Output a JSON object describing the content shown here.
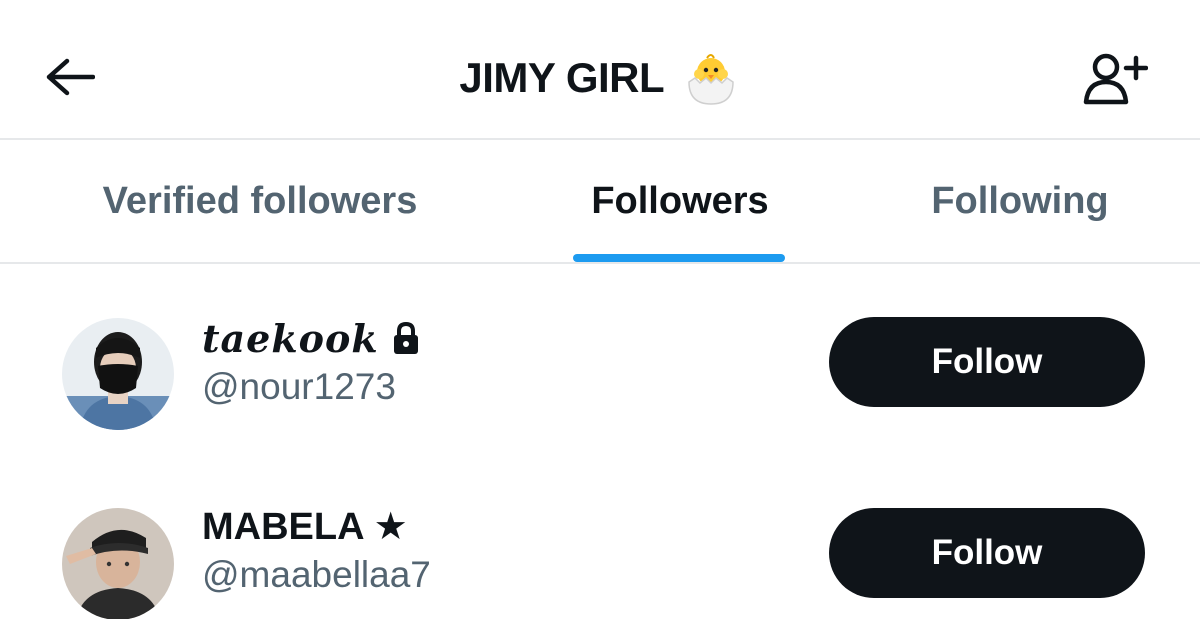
{
  "header": {
    "title": "JIMY GIRL",
    "title_emoji_icon": "hatching-chick-icon",
    "back_icon": "arrow-left-icon",
    "add_icon": "add-person-icon"
  },
  "tabs": [
    {
      "label": "Verified followers",
      "active": false
    },
    {
      "label": "Followers",
      "active": true
    },
    {
      "label": "Following",
      "active": false
    }
  ],
  "accent_color": "#1d9bf0",
  "users": [
    {
      "display_name": "𝒕𝒂𝒆𝒌𝒐𝒐𝒌",
      "handle": "@nour1273",
      "protected": true,
      "button_label": "Follow"
    },
    {
      "display_name": "MABELA ★",
      "handle": "@maabellaa7",
      "protected": false,
      "button_label": "Follow"
    }
  ]
}
